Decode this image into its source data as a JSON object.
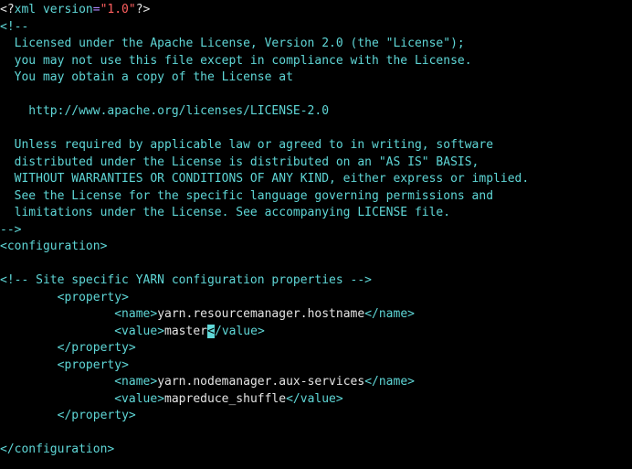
{
  "colors": {
    "background": "#000000",
    "teal": "#5fd7d7",
    "white": "#e4e4e4",
    "purple": "#af87ff",
    "red": "#ff5f5f"
  },
  "xml_decl": {
    "open": "<?",
    "name": "xml version",
    "eq": "=",
    "version_value": "\"1.0\"",
    "close": "?>"
  },
  "license": {
    "open": "<!--",
    "l1": "  Licensed under the Apache License, Version 2.0 (the \"License\");",
    "l2": "  you may not use this file except in compliance with the License.",
    "l3": "  You may obtain a copy of the License at",
    "blank1": "",
    "l4": "    http://www.apache.org/licenses/LICENSE-2.0",
    "blank2": "",
    "l5": "  Unless required by applicable law or agreed to in writing, software",
    "l6": "  distributed under the License is distributed on an \"AS IS\" BASIS,",
    "l7": "  WITHOUT WARRANTIES OR CONDITIONS OF ANY KIND, either express or implied.",
    "l8": "  See the License for the specific language governing permissions and",
    "l9": "  limitations under the License. See accompanying LICENSE file.",
    "close": "-->"
  },
  "tags": {
    "configuration_open": "<configuration>",
    "configuration_close": "</configuration>",
    "site_comment": "<!-- Site specific YARN configuration properties -->",
    "property_open": "<property>",
    "property_close": "</property>",
    "name_open": "<name>",
    "name_close": "</name>",
    "value_open": "<value>",
    "value_close": "</value>"
  },
  "indent": {
    "i8": "        ",
    "i16": "                "
  },
  "props": [
    {
      "name": "yarn.resourcemanager.hostname",
      "value": "master"
    },
    {
      "name": "yarn.nodemanager.aux-services",
      "value": "mapreduce_shuffle"
    }
  ],
  "cursor_char": "<"
}
